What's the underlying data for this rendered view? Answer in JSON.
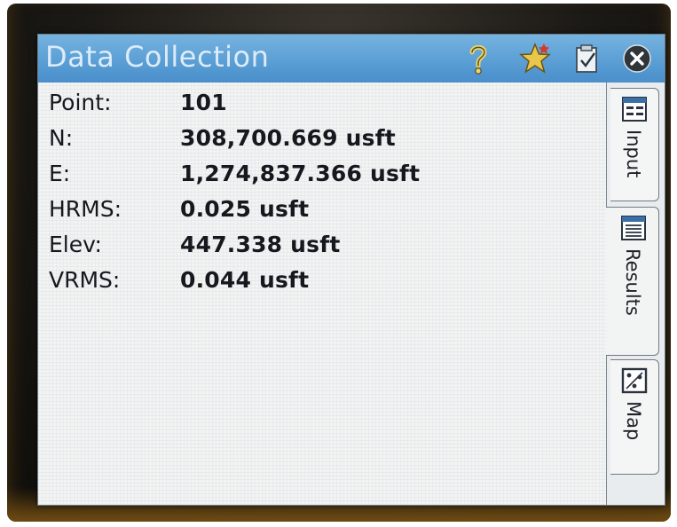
{
  "window": {
    "title": "Data Collection",
    "accent_color": "#5b9fd5"
  },
  "toolbar": {
    "help_icon": "question-mark-icon",
    "favorites_icon": "star-icon",
    "files_icon": "clipboard-check-icon",
    "close_icon": "close-icon"
  },
  "results": [
    {
      "label": "Point:",
      "value": "101"
    },
    {
      "label": "N:",
      "value": "308,700.669 usft"
    },
    {
      "label": "E:",
      "value": "1,274,837.366 usft"
    },
    {
      "label": "HRMS:",
      "value": "0.025 usft"
    },
    {
      "label": "Elev:",
      "value": "447.338 usft"
    },
    {
      "label": "VRMS:",
      "value": "0.044 usft"
    }
  ],
  "tabs": [
    {
      "label": "Input",
      "icon": "input-form-icon",
      "active": false
    },
    {
      "label": "Results",
      "icon": "results-list-icon",
      "active": true
    },
    {
      "label": "Map",
      "icon": "map-icon",
      "active": false
    }
  ]
}
